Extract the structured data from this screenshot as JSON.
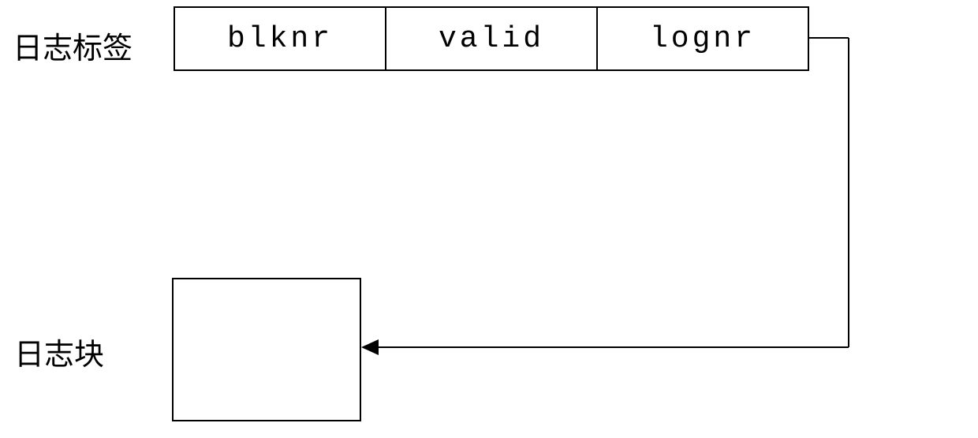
{
  "labels": {
    "top": "日志标签",
    "bottom": "日志块"
  },
  "fields": {
    "f0": "blknr",
    "f1": "valid",
    "f2": "lognr"
  }
}
